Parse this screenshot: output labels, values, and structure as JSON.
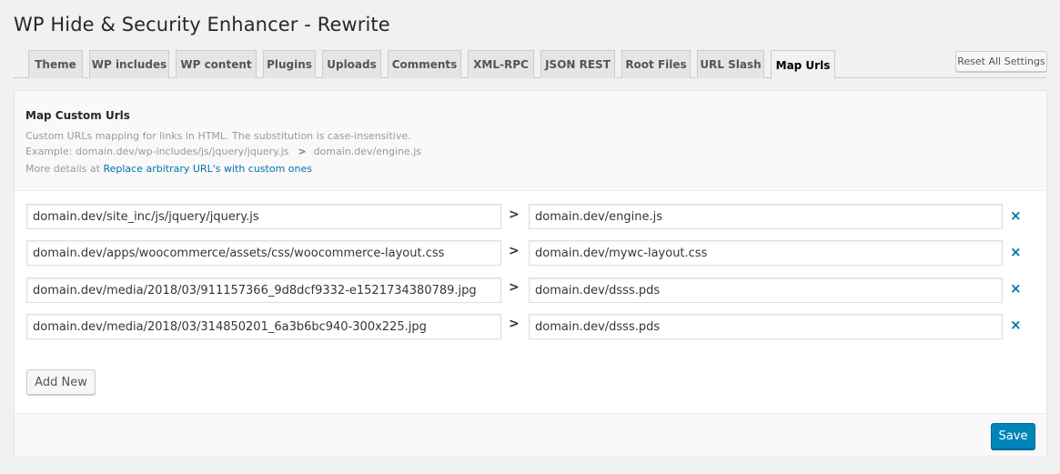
{
  "page": {
    "title": "WP Hide & Security Enhancer - Rewrite"
  },
  "tabs": [
    {
      "label": "Theme"
    },
    {
      "label": "WP includes"
    },
    {
      "label": "WP content"
    },
    {
      "label": "Plugins"
    },
    {
      "label": "Uploads"
    },
    {
      "label": "Comments"
    },
    {
      "label": "XML-RPC"
    },
    {
      "label": "JSON REST"
    },
    {
      "label": "Root Files"
    },
    {
      "label": "URL Slash"
    },
    {
      "label": "Map Urls",
      "active": true
    }
  ],
  "reset_label": "Reset All Settings",
  "section": {
    "title": "Map Custom Urls",
    "description": "Custom URLs mapping for links in HTML. The substitution is case-insensitive.",
    "example_prefix": "Example: domain.dev/wp-includes/js/jquery/jquery.js",
    "example_arrow": ">",
    "example_target": "domain.dev/engine.js",
    "details_prefix": "More details at",
    "details_link": "Replace arbitrary URL's with custom ones"
  },
  "mappings": [
    {
      "from": "domain.dev/site_inc/js/jquery/jquery.js",
      "to": "domain.dev/engine.js"
    },
    {
      "from": "domain.dev/apps/woocommerce/assets/css/woocommerce-layout.css",
      "to": "domain.dev/mywc-layout.css"
    },
    {
      "from": "domain.dev/media/2018/03/911157366_9d8dcf9332-e1521734380789.jpg",
      "to": "domain.dev/dsss.pds"
    },
    {
      "from": "domain.dev/media/2018/03/314850201_6a3b6bc940-300x225.jpg",
      "to": "domain.dev/dsss.pds"
    }
  ],
  "row_arrow": ">",
  "remove_icon": "×",
  "add_new_label": "Add New",
  "save_label": "Save",
  "colors": {
    "accent": "#0073aa",
    "primary_button": "#0085ba"
  }
}
